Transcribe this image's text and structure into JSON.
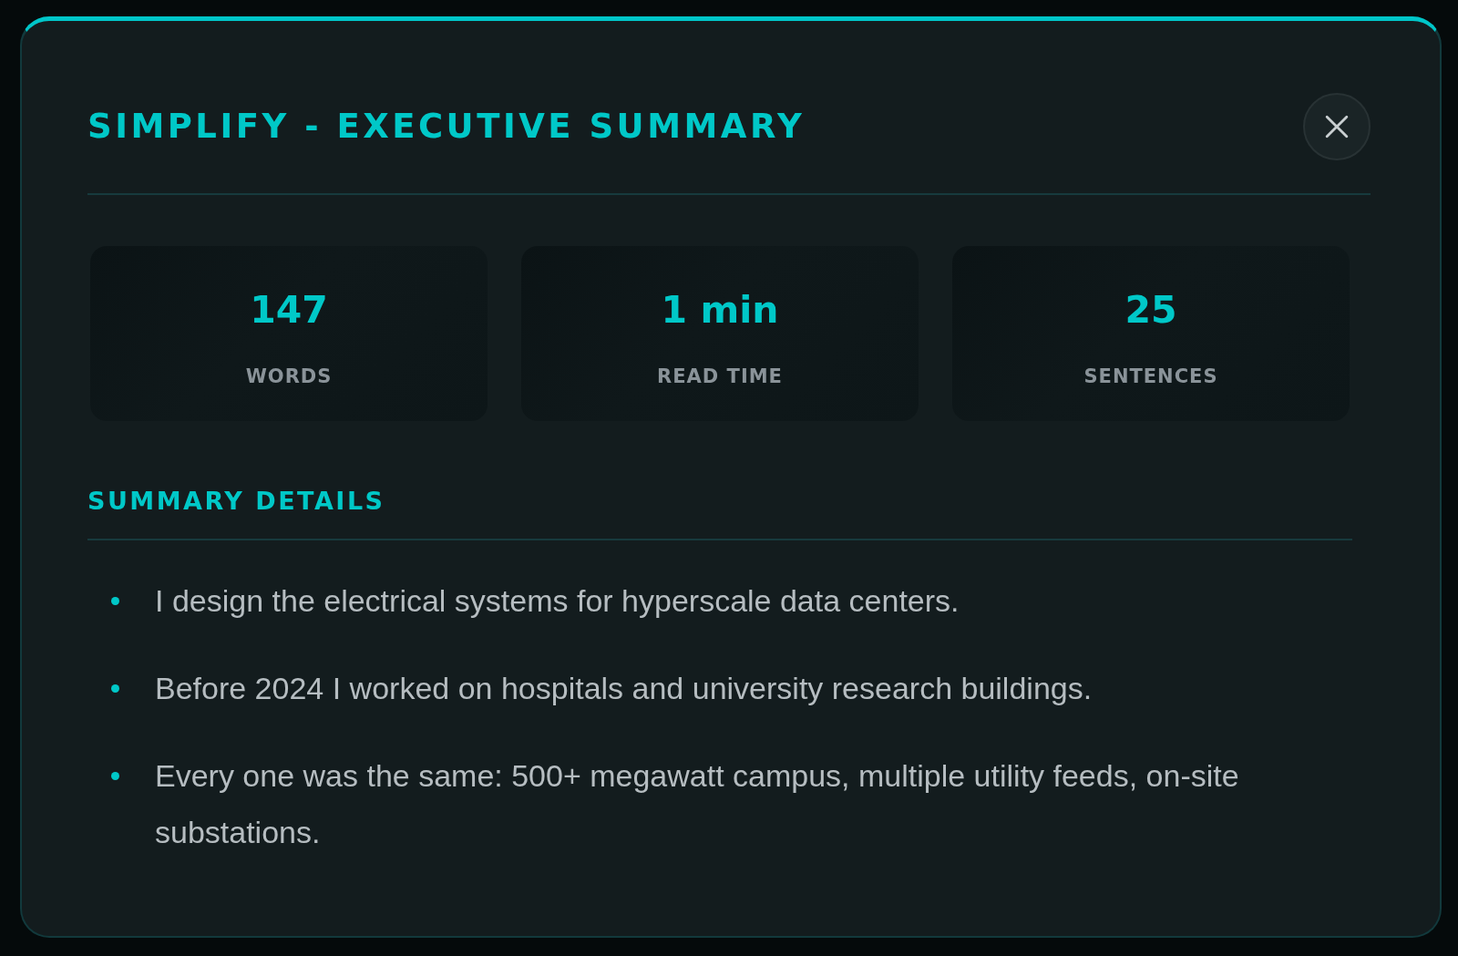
{
  "modal": {
    "title": "SIMPLIFY - EXECUTIVE SUMMARY"
  },
  "stats": [
    {
      "value": "147",
      "label": "WORDS"
    },
    {
      "value": "1 min",
      "label": "READ TIME"
    },
    {
      "value": "25",
      "label": "SENTENCES"
    }
  ],
  "details": {
    "heading": "SUMMARY DETAILS",
    "items": [
      "I design the electrical systems for hyperscale data centers.",
      "Before 2024 I worked on hospitals and university research buildings.",
      "Every one was the same: 500+ megawatt campus, multiple utility feeds, on-site substations."
    ]
  }
}
